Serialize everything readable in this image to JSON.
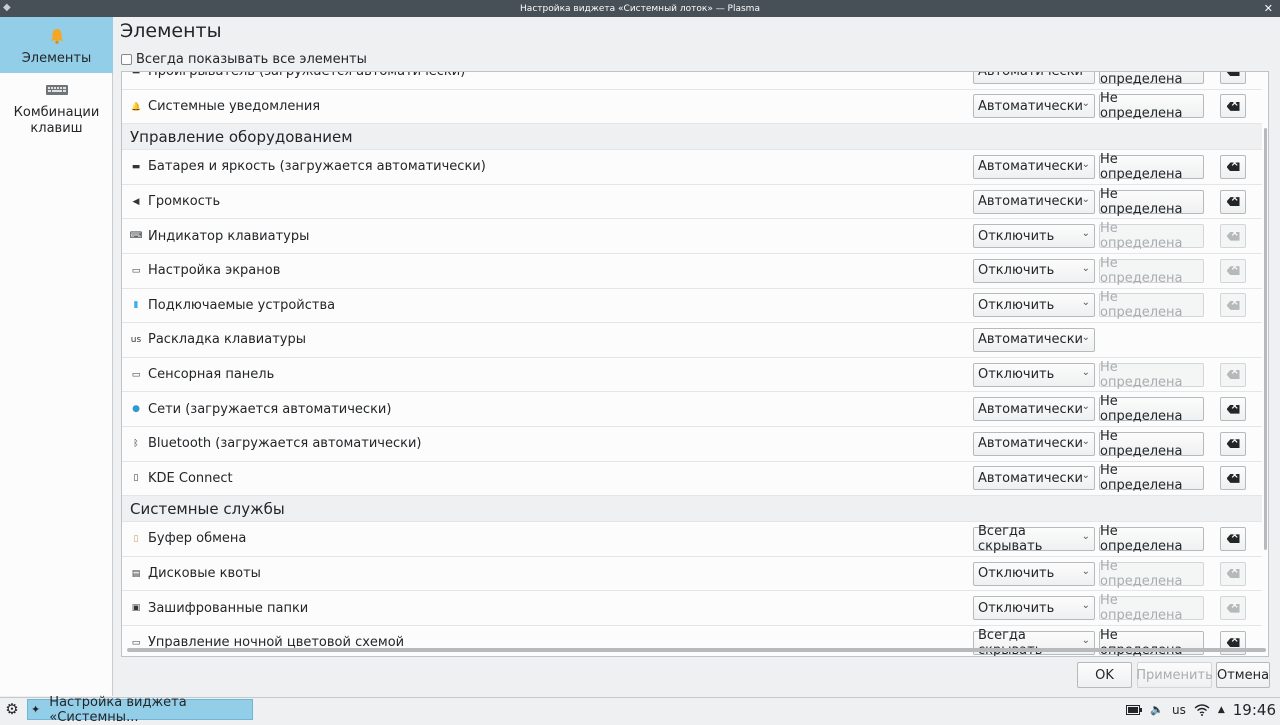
{
  "window": {
    "title": "Настройка виджета «Системный лоток» — Plasma"
  },
  "sidebar": {
    "items": [
      {
        "label": "Элементы",
        "icon": "bell-icon",
        "active": true
      },
      {
        "label": "Комбинации клавиш",
        "label_line1": "Комбинации",
        "label_line2": "клавиш",
        "icon": "keyboard-icon",
        "active": false
      }
    ]
  },
  "main": {
    "title": "Элементы",
    "show_all_label": "Всегда показывать все элементы"
  },
  "list": {
    "rows": [
      {
        "kind": "item",
        "label": "Проигрыватель (загружается автоматически)",
        "icon": "media-player-icon",
        "visibility": "Автоматически",
        "shortcut": "Не определена",
        "enabled": true
      },
      {
        "kind": "item",
        "label": "Системные уведомления",
        "icon": "bell-icon",
        "visibility": "Автоматически",
        "shortcut": "Не определена",
        "enabled": true
      },
      {
        "kind": "section",
        "label": "Управление оборудованием"
      },
      {
        "kind": "item",
        "label": "Батарея и яркость (загружается автоматически)",
        "icon": "battery-icon",
        "visibility": "Автоматически",
        "shortcut": "Не определена",
        "enabled": true
      },
      {
        "kind": "item",
        "label": "Громкость",
        "icon": "speaker-icon",
        "visibility": "Автоматически",
        "shortcut": "Не определена",
        "enabled": true
      },
      {
        "kind": "item",
        "label": "Индикатор клавиатуры",
        "icon": "keyboard-indicator-icon",
        "visibility": "Отключить",
        "shortcut": "Не определена",
        "enabled": false
      },
      {
        "kind": "item",
        "label": "Настройка экранов",
        "icon": "monitor-icon",
        "visibility": "Отключить",
        "shortcut": "Не определена",
        "enabled": false
      },
      {
        "kind": "item",
        "label": "Подключаемые устройства",
        "icon": "usb-drive-icon",
        "visibility": "Отключить",
        "shortcut": "Не определена",
        "enabled": false
      },
      {
        "kind": "item",
        "label": "Раскладка клавиатуры",
        "icon": "keyboard-layout-icon",
        "icon_text": "us",
        "visibility": "Автоматически",
        "shortcut": null,
        "enabled": true
      },
      {
        "kind": "item",
        "label": "Сенсорная панель",
        "icon": "touchpad-icon",
        "visibility": "Отключить",
        "shortcut": "Не определена",
        "enabled": false
      },
      {
        "kind": "item",
        "label": "Сети (загружается автоматически)",
        "icon": "network-globe-icon",
        "visibility": "Автоматически",
        "shortcut": "Не определена",
        "enabled": true
      },
      {
        "kind": "item",
        "label": "Bluetooth (загружается автоматически)",
        "icon": "bluetooth-icon",
        "visibility": "Автоматически",
        "shortcut": "Не определена",
        "enabled": true
      },
      {
        "kind": "item",
        "label": "KDE Connect",
        "icon": "phone-icon",
        "visibility": "Автоматически",
        "shortcut": "Не определена",
        "enabled": true
      },
      {
        "kind": "section",
        "label": "Системные службы"
      },
      {
        "kind": "item",
        "label": "Буфер обмена",
        "icon": "clipboard-icon",
        "visibility": "Всегда скрывать",
        "shortcut": "Не определена",
        "enabled": true
      },
      {
        "kind": "item",
        "label": "Дисковые квоты",
        "icon": "disk-quota-icon",
        "visibility": "Отключить",
        "shortcut": "Не определена",
        "enabled": false
      },
      {
        "kind": "item",
        "label": "Зашифрованные папки",
        "icon": "encrypted-folder-icon",
        "visibility": "Отключить",
        "shortcut": "Не определена",
        "enabled": false
      },
      {
        "kind": "item",
        "label": "Управление ночной цветовой схемой",
        "icon": "night-color-icon",
        "visibility": "Всегда скрывать",
        "shortcut": "Не определена",
        "enabled": true
      }
    ]
  },
  "buttons": {
    "ok": "OK",
    "apply": "Применить",
    "cancel": "Отмена"
  },
  "taskbar": {
    "task_label": "Настройка виджета «Системны...",
    "keyboard_layout": "us",
    "clock": "19:46"
  },
  "colors": {
    "accent": "#93cee9",
    "titlebar": "#475057",
    "window_bg": "#eff0f1",
    "view_bg": "#fcfcfc"
  }
}
